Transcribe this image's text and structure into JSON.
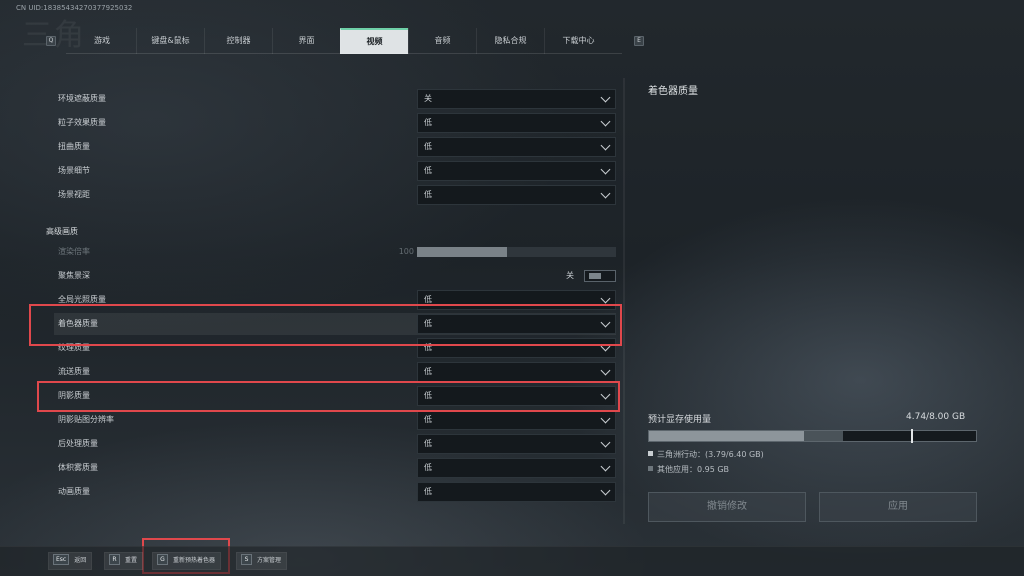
{
  "uid": "CN UID:18385434270377925032",
  "tabs": {
    "left_key": "Q",
    "right_key": "E",
    "items": [
      {
        "label": "游戏"
      },
      {
        "label": "键盘&鼠标"
      },
      {
        "label": "控制器"
      },
      {
        "label": "界面"
      },
      {
        "label": "视频",
        "active": true
      },
      {
        "label": "音频"
      },
      {
        "label": "隐私合规"
      },
      {
        "label": "下载中心"
      }
    ]
  },
  "settings_top": [
    {
      "label": "环境遮蔽质量",
      "value": "关"
    },
    {
      "label": "粒子效果质量",
      "value": "低"
    },
    {
      "label": "扭曲质量",
      "value": "低"
    },
    {
      "label": "场景细节",
      "value": "低"
    },
    {
      "label": "场景视距",
      "value": "低"
    }
  ],
  "advanced": {
    "title": "高级画质",
    "render_scale": {
      "label": "渲染倍率",
      "value": "100",
      "fill_fraction": 0.45
    },
    "dof": {
      "label": "聚焦景深",
      "state": "关"
    },
    "rows": [
      {
        "label": "全局光照质量",
        "value": "低"
      },
      {
        "label": "着色器质量",
        "value": "低"
      },
      {
        "label": "纹理质量",
        "value": "低"
      },
      {
        "label": "流送质量",
        "value": "低"
      },
      {
        "label": "阴影质量",
        "value": "低"
      },
      {
        "label": "阴影贴图分辨率",
        "value": "低"
      },
      {
        "label": "后处理质量",
        "value": "低"
      },
      {
        "label": "体积雾质量",
        "value": "低"
      },
      {
        "label": "动画质量",
        "value": "低"
      }
    ]
  },
  "info": {
    "title": "着色器质量",
    "vram_label": "预计显存使用量",
    "vram_value": "4.74/8.00 GB",
    "game_usage_fraction": 0.474,
    "total_usage_fraction": 0.5925,
    "marker_fraction": 0.8,
    "legend_game": "三角洲行动：(3.79/6.40 GB)",
    "legend_other": "其他应用：0.95 GB",
    "colors": {
      "game": "#8d959b",
      "other": "#4a5359"
    }
  },
  "buttons": {
    "revert": "撤销修改",
    "apply": "应用"
  },
  "bottom": [
    {
      "key": "Esc",
      "label": "返回"
    },
    {
      "key": "R",
      "label": "重置"
    },
    {
      "key": "G",
      "label": "重新预热着色器"
    },
    {
      "key": "S",
      "label": "方案管理"
    }
  ],
  "highlight_color": "#e0484c"
}
